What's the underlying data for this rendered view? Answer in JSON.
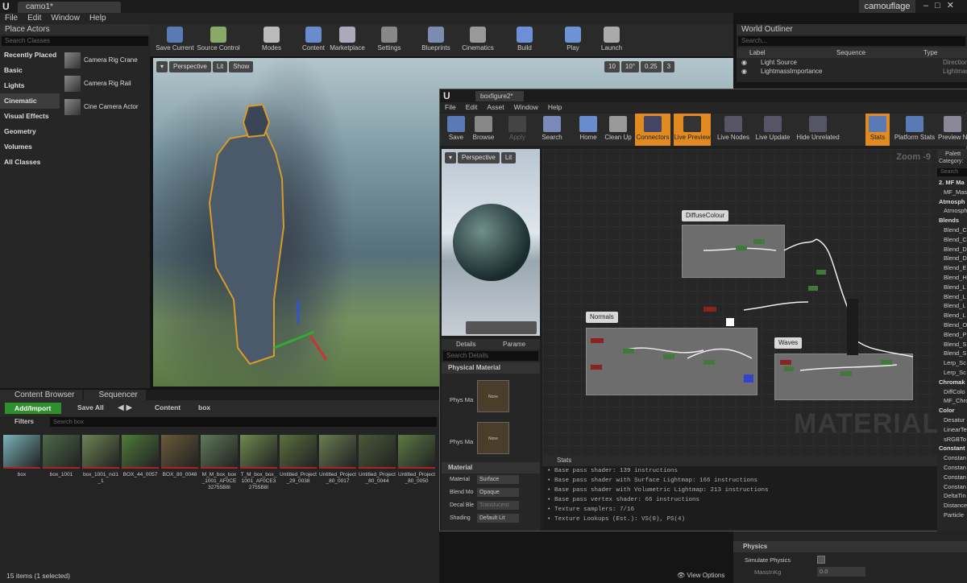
{
  "app": {
    "tab": "camo1*",
    "project": "camouflage"
  },
  "menu": [
    "File",
    "Edit",
    "Window",
    "Help"
  ],
  "place_actors": {
    "title": "Place Actors",
    "search_placeholder": "Search Classes",
    "categories": [
      "Recently Placed",
      "Basic",
      "Lights",
      "Cinematic",
      "Visual Effects",
      "Geometry",
      "Volumes",
      "All Classes"
    ],
    "actors": [
      "Camera Rig Crane",
      "Camera Rig Rail",
      "Cine Camera Actor"
    ]
  },
  "toolbar": [
    "Save Current",
    "Source Control",
    "Modes",
    "Content",
    "Marketplace",
    "Settings",
    "Blueprints",
    "Cinematics",
    "Build",
    "Play",
    "Launch"
  ],
  "viewport": {
    "perspective": "Perspective",
    "lit": "Lit",
    "show": "Show",
    "snap_values": [
      "10",
      "10°",
      "0.25",
      "3"
    ]
  },
  "outliner": {
    "title": "World Outliner",
    "search_placeholder": "Search...",
    "cols": [
      "Label",
      "Sequence",
      "Type"
    ],
    "rows": [
      {
        "label": "Light Source",
        "type": "DirectionalLi"
      },
      {
        "label": "LightmassImportance",
        "type": "LightmassIm"
      }
    ]
  },
  "content_browser": {
    "tabs": [
      "Content Browser",
      "Sequencer"
    ],
    "add": "Add/Import",
    "save": "Save All",
    "path": [
      "Content",
      "box"
    ],
    "filters": "Filters",
    "search_placeholder": "Search box",
    "items": [
      "box",
      "box_1001",
      "box_1001_ncl1_1",
      "BOX_44_0057",
      "BOX_80_0048",
      "M_M_box_box_1001_AF0CE32755B8I",
      "T_M_box_box_1001_AF0CE32755B8I",
      "Untitled_Project_29_0038",
      "Untitled_Project_80_0017",
      "Untitled_Project_80_0044",
      "Untitled_Project_80_0050"
    ],
    "status": "15 items (1 selected)",
    "view_options": "View Options"
  },
  "editor": {
    "tab": "boxfigure2*",
    "menu": [
      "File",
      "Edit",
      "Asset",
      "Window",
      "Help"
    ],
    "toolbar": [
      "Save",
      "Browse",
      "Apply",
      "Search",
      "Home",
      "Clean Up",
      "Connectors",
      "Live Preview",
      "Live Nodes",
      "Live Update",
      "Hide Unrelated",
      "Stats",
      "Platform Stats",
      "Preview N"
    ],
    "preview": {
      "perspective": "Perspective",
      "lit": "Lit"
    },
    "zoom": "Zoom -9",
    "watermark": "MATERIAL",
    "nodes": [
      "DiffuseColour",
      "Normals",
      "Waves"
    ],
    "details": {
      "tabs": [
        "Details",
        "Parame"
      ],
      "search_placeholder": "Search Details",
      "sections": [
        "Physical Material",
        "Material"
      ],
      "phys_labels": [
        "Phys Ma",
        "Phys Ma"
      ],
      "none": "None",
      "props": [
        {
          "label": "Material",
          "value": "Surface"
        },
        {
          "label": "Blend Mo",
          "value": "Opaque"
        },
        {
          "label": "Decal Ble",
          "value": "Translucent"
        },
        {
          "label": "Shading",
          "value": "Default Lit"
        }
      ]
    },
    "stats": {
      "title": "Stats",
      "lines": [
        "Base pass shader: 139 instructions",
        "Base pass shader with Surface Lightmap: 166 instructions",
        "Base pass shader with Volumetric Lightmap: 213 instructions",
        "Base pass vertex shader: 66 instructions",
        "Texture samplers: 7/16",
        "Texture Lookups (Est.): VS(0), PS(4)"
      ]
    },
    "palette": {
      "title": "Palett",
      "category": "Category:",
      "search": "Search",
      "items": [
        {
          "t": "2. MF Ma",
          "h": true
        },
        {
          "t": "MF_Mas"
        },
        {
          "t": "Atmosph",
          "h": true
        },
        {
          "t": "Atmosph"
        },
        {
          "t": "Blends",
          "h": true
        },
        {
          "t": "Blend_C"
        },
        {
          "t": "Blend_C"
        },
        {
          "t": "Blend_D"
        },
        {
          "t": "Blend_D"
        },
        {
          "t": "Blend_E"
        },
        {
          "t": "Blend_H"
        },
        {
          "t": "Blend_L"
        },
        {
          "t": "Blend_L"
        },
        {
          "t": "Blend_L"
        },
        {
          "t": "Blend_L"
        },
        {
          "t": "Blend_O"
        },
        {
          "t": "Blend_P"
        },
        {
          "t": "Blend_S"
        },
        {
          "t": "Blend_S"
        },
        {
          "t": "Lerp_Sc"
        },
        {
          "t": "Lerp_Sc"
        },
        {
          "t": "Chromak",
          "h": true
        },
        {
          "t": "DiffColo"
        },
        {
          "t": "MF_Chro"
        },
        {
          "t": "Color",
          "h": true
        },
        {
          "t": "Desatur"
        },
        {
          "t": "LinearTe"
        },
        {
          "t": "sRGBTo"
        },
        {
          "t": "Constant",
          "h": true
        },
        {
          "t": "Constan"
        },
        {
          "t": "Constan"
        },
        {
          "t": "Constan"
        },
        {
          "t": "Constan"
        },
        {
          "t": "DeltaTin"
        },
        {
          "t": "Distance"
        },
        {
          "t": "Particle"
        }
      ]
    }
  },
  "physics": {
    "title": "Physics",
    "simulate": "Simulate Physics",
    "mass": "MassInKg",
    "mass_value": "0.0"
  }
}
